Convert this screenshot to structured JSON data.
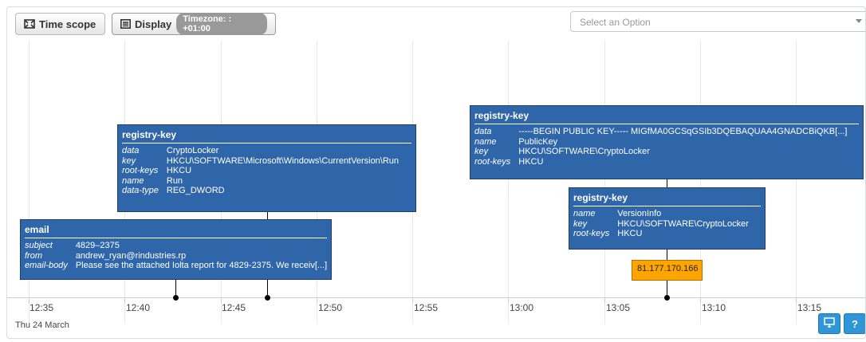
{
  "toolbar": {
    "time_scope_label": "Time scope",
    "display_label": "Display",
    "timezone_badge": "Timezone: : +01:00",
    "select_placeholder": "Select an Option"
  },
  "timeline": {
    "ticks": [
      "12:35",
      "12:40",
      "12:45",
      "12:50",
      "12:55",
      "13:00",
      "13:05",
      "13:10",
      "13:15"
    ],
    "date_label": "Thu 24 March"
  },
  "cards": {
    "registry1": {
      "title": "registry-key",
      "rows": [
        {
          "k": "data",
          "v": "CryptoLocker"
        },
        {
          "k": "key",
          "v": "HKCU\\SOFTWARE\\Microsoft\\Windows\\CurrentVersion\\Run"
        },
        {
          "k": "root-keys",
          "v": "HKCU"
        },
        {
          "k": "name",
          "v": "Run"
        },
        {
          "k": "data-type",
          "v": "REG_DWORD"
        }
      ]
    },
    "email": {
      "title": "email",
      "rows": [
        {
          "k": "subject",
          "v": "4829–2375"
        },
        {
          "k": "from",
          "v": "andrew_ryan@rindustries.rp"
        },
        {
          "k": "email-body",
          "v": "Please see the attached Iolta report for 4829-2375. We receiv[...]"
        }
      ]
    },
    "registry2": {
      "title": "registry-key",
      "rows": [
        {
          "k": "data",
          "v": "-----BEGIN PUBLIC KEY----- MIGfMA0GCSqGSIb3DQEBAQUAA4GNADCBiQKB[...]"
        },
        {
          "k": "name",
          "v": "PublicKey"
        },
        {
          "k": "key",
          "v": "HKCU\\SOFTWARE\\CryptoLocker"
        },
        {
          "k": "root-keys",
          "v": "HKCU"
        }
      ]
    },
    "registry3": {
      "title": "registry-key",
      "rows": [
        {
          "k": "name",
          "v": "VersionInfo"
        },
        {
          "k": "key",
          "v": "HKCU\\SOFTWARE\\CryptoLocker"
        },
        {
          "k": "root-keys",
          "v": "HKCU"
        }
      ]
    }
  },
  "ip_address": "81.177.170.166",
  "buttons": {
    "help_label": "?"
  },
  "colors": {
    "card_bg": "#2f66a9",
    "ip_bg": "#ffa500",
    "corner_button": "#2f96d8"
  }
}
